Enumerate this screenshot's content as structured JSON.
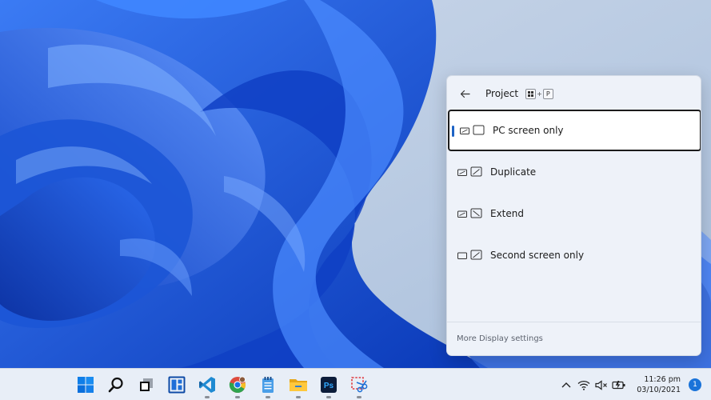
{
  "project_flyout": {
    "title": "Project",
    "shortcut_key": "P",
    "shortcut_plus": "+",
    "options": [
      {
        "label": "PC screen only",
        "selected": true
      },
      {
        "label": "Duplicate",
        "selected": false
      },
      {
        "label": "Extend",
        "selected": false
      },
      {
        "label": "Second screen only",
        "selected": false
      }
    ],
    "more_settings": "More Display settings"
  },
  "taskbar": {
    "apps": [
      {
        "name": "start",
        "icon": "windows-logo-icon"
      },
      {
        "name": "search",
        "icon": "search-icon"
      },
      {
        "name": "task-view",
        "icon": "task-view-icon"
      },
      {
        "name": "widgets",
        "icon": "widgets-icon"
      },
      {
        "name": "vscode",
        "icon": "vscode-icon"
      },
      {
        "name": "chrome",
        "icon": "chrome-icon"
      },
      {
        "name": "notepad",
        "icon": "notepad-icon"
      },
      {
        "name": "file-explorer",
        "icon": "folder-icon"
      },
      {
        "name": "photoshop",
        "icon": "photoshop-icon",
        "text": "Ps"
      },
      {
        "name": "snipping-tool",
        "icon": "snipping-tool-icon"
      }
    ],
    "clock": {
      "time": "11:26 pm",
      "date": "03/10/2021"
    },
    "notification_count": "1"
  },
  "colors": {
    "accent": "#1e63c5",
    "wallpaper_blue": "#1552d9",
    "taskbar_bg": "#e8eef7",
    "badge": "#1a73d9"
  }
}
